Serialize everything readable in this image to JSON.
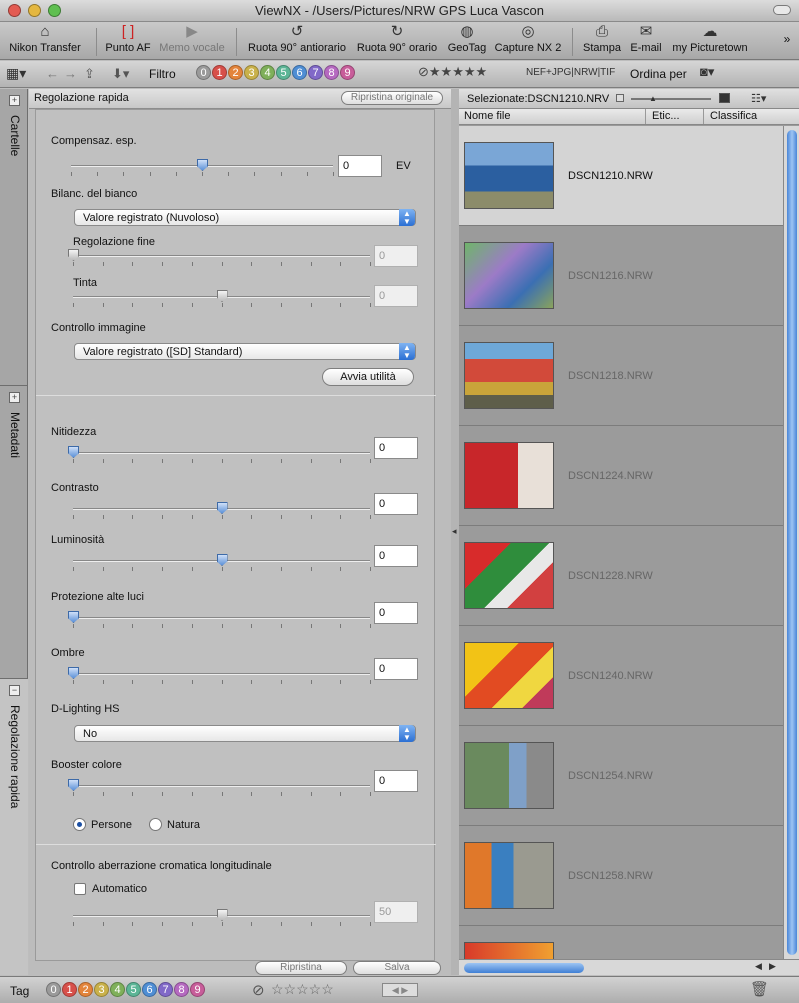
{
  "window": {
    "title": "ViewNX - /Users/Pictures/NRW GPS Luca Vascon"
  },
  "toolbar": {
    "items": [
      {
        "label": "Nikon Transfer",
        "icon": "camera-transfer-icon",
        "glyph": "⌂"
      },
      {
        "label": "Punto AF",
        "icon": "af-point-icon",
        "glyph": "[ ]"
      },
      {
        "label": "Memo vocale",
        "icon": "voice-memo-icon",
        "glyph": "▶"
      },
      {
        "label": "Ruota 90° antiorario",
        "icon": "rotate-ccw-icon",
        "glyph": "↺"
      },
      {
        "label": "Ruota 90° orario",
        "icon": "rotate-cw-icon",
        "glyph": "↻"
      },
      {
        "label": "GeoTag",
        "icon": "globe-icon",
        "glyph": "◍"
      },
      {
        "label": "Capture NX 2",
        "icon": "capture-nx-icon",
        "glyph": "◎"
      },
      {
        "label": "Stampa",
        "icon": "printer-icon",
        "glyph": "⎙"
      },
      {
        "label": "E-mail",
        "icon": "envelope-icon",
        "glyph": "✉"
      },
      {
        "label": "my Picturetown",
        "icon": "picturetown-icon",
        "glyph": "☁"
      }
    ],
    "more": "»"
  },
  "filterbar": {
    "filter_label": "Filtro",
    "labels": [
      "0",
      "1",
      "2",
      "3",
      "4",
      "5",
      "6",
      "7",
      "8",
      "9"
    ],
    "label_colors": [
      "#9a9a9a",
      "#d7504a",
      "#e3843b",
      "#c9b14a",
      "#7fb05a",
      "#5cb596",
      "#4f8ed4",
      "#8169c8",
      "#b569c0",
      "#c85d9a"
    ],
    "stars": "★★★★★",
    "formats": "NEF+JPG|NRW|TIF",
    "sort_label": "Ordina per"
  },
  "sidetabs": [
    {
      "label": "Cartelle",
      "toggle": "+"
    },
    {
      "label": "Metadati",
      "toggle": "+"
    },
    {
      "label": "Regolazione rapida",
      "toggle": "−"
    }
  ],
  "panel": {
    "title": "Regolazione rapida",
    "restore_original": "Ripristina originale",
    "exposure": {
      "label": "Compensaz. esp.",
      "value": "0",
      "unit": "EV",
      "level": 0.5
    },
    "white_balance": {
      "label": "Bilanc. del bianco",
      "selected": "Valore registrato (Nuvoloso)"
    },
    "fine_tune": {
      "label": "Regolazione fine",
      "value": "0",
      "level": 0.0
    },
    "tint": {
      "label": "Tinta",
      "value": "0",
      "level": 0.5
    },
    "picture_control": {
      "label": "Controllo immagine",
      "selected": "Valore registrato ([SD] Standard)",
      "launch": "Avvia utilità"
    },
    "sharpness": {
      "label": "Nitidezza",
      "value": "0",
      "level": 0.0
    },
    "contrast": {
      "label": "Contrasto",
      "value": "0",
      "level": 0.5
    },
    "brightness": {
      "label": "Luminosità",
      "value": "0",
      "level": 0.5
    },
    "highlight": {
      "label": "Protezione alte luci",
      "value": "0",
      "level": 0.0
    },
    "shadows": {
      "label": "Ombre",
      "value": "0",
      "level": 0.0
    },
    "dlighting": {
      "label": "D-Lighting HS",
      "selected": "No"
    },
    "color_booster": {
      "label": "Booster colore",
      "value": "0",
      "level": 0.0,
      "people": "Persone",
      "nature": "Natura"
    },
    "aberration": {
      "label": "Controllo aberrazione cromatica longitudinale",
      "auto": "Automatico",
      "value": "50",
      "level": 0.5
    },
    "reset": "Ripristina",
    "save": "Salva"
  },
  "browser": {
    "selected_label": "Selezionate:DSCN1210.NRV",
    "columns": [
      "Nome file",
      "Etic...",
      "Classifica"
    ],
    "files": [
      {
        "name": "DSCN1210.NRW",
        "selected": true
      },
      {
        "name": "DSCN1216.NRW",
        "selected": false
      },
      {
        "name": "DSCN1218.NRW",
        "selected": false
      },
      {
        "name": "DSCN1224.NRW",
        "selected": false
      },
      {
        "name": "DSCN1228.NRW",
        "selected": false
      },
      {
        "name": "DSCN1240.NRW",
        "selected": false
      },
      {
        "name": "DSCN1254.NRW",
        "selected": false
      },
      {
        "name": "DSCN1258.NRW",
        "selected": false
      }
    ]
  },
  "statusbar": {
    "tag_label": "Tag",
    "stars": "☆☆☆☆☆"
  }
}
